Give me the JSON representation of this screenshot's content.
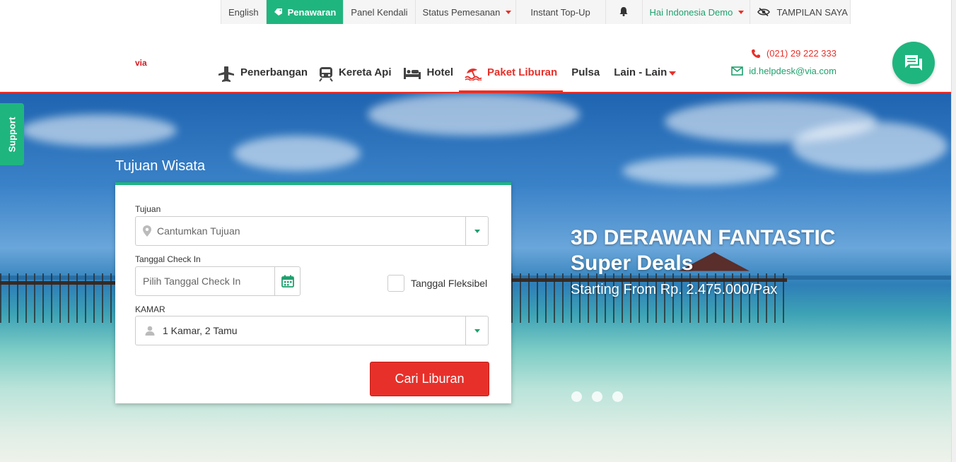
{
  "topbar": {
    "language": "English",
    "promo": "Penawaran",
    "dashboard": "Panel Kendali",
    "order_status": "Status Pemesanan",
    "topup": "Instant Top-Up",
    "greeting": "Hai Indonesia Demo",
    "view": "TAMPILAN SAYA"
  },
  "header": {
    "logo_text": "via",
    "nav": [
      {
        "label": "Penerbangan",
        "icon": "airplane-icon"
      },
      {
        "label": "Kereta Api",
        "icon": "train-icon"
      },
      {
        "label": "Hotel",
        "icon": "bed-icon"
      },
      {
        "label": "Paket Liburan",
        "icon": "beach-icon",
        "active": true
      },
      {
        "label": "Pulsa"
      },
      {
        "label": "Lain - Lain"
      }
    ],
    "phone": "(021) 29 222 333",
    "email": "id.helpdesk@via.com"
  },
  "support": "Support",
  "search": {
    "title": "Tujuan Wisata",
    "destination_label": "Tujuan",
    "destination_placeholder": "Cantumkan Tujuan",
    "checkin_label": "Tanggal Check In",
    "checkin_placeholder": "Pilih Tanggal Check In",
    "flexible_label": "Tanggal Fleksibel",
    "room_label": "KAMAR",
    "room_value": "1 Kamar, 2 Tamu",
    "button": "Cari Liburan"
  },
  "promo": {
    "title_line1": "3D DERAWAN FANTASTIC",
    "title_line2": "Super Deals",
    "subtitle": "Starting From Rp. 2.475.000/Pax"
  },
  "colors": {
    "accent_red": "#e8302a",
    "brand_green": "#1fb57f"
  }
}
